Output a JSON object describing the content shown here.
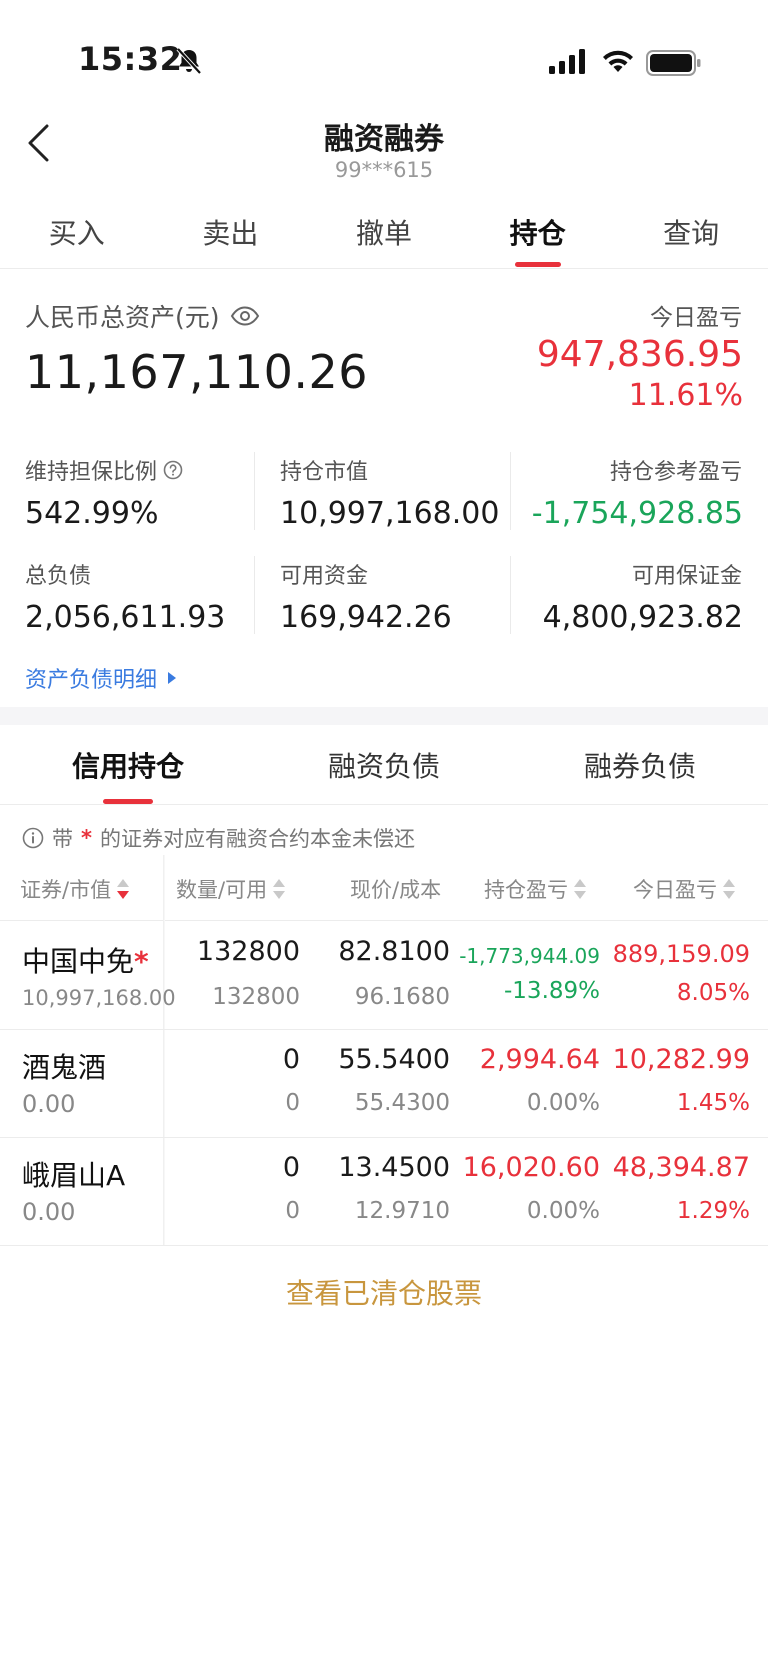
{
  "status_bar": {
    "time": "15:32"
  },
  "header": {
    "title": "融资融券",
    "account": "99***615"
  },
  "tabs": [
    {
      "label": "买入"
    },
    {
      "label": "卖出"
    },
    {
      "label": "撤单"
    },
    {
      "label": "持仓",
      "active": true
    },
    {
      "label": "查询"
    }
  ],
  "summary": {
    "total_assets_label": "人民币总资产(元)",
    "total_assets": "11,167,110.26",
    "today_pl_label": "今日盈亏",
    "today_pl_value": "947,836.95",
    "today_pl_pct": "11.61%",
    "metrics": {
      "maintenance_ratio_label": "维持担保比例",
      "maintenance_ratio": "542.99%",
      "position_mv_label": "持仓市值",
      "position_mv": "10,997,168.00",
      "position_pl_label": "持仓参考盈亏",
      "position_pl": "-1,754,928.85",
      "total_liab_label": "总负债",
      "total_liab": "2,056,611.93",
      "available_funds_label": "可用资金",
      "available_funds": "169,942.26",
      "available_margin_label": "可用保证金",
      "available_margin": "4,800,923.82"
    },
    "detail_link": "资产负债明细"
  },
  "sub_tabs": [
    {
      "label": "信用持仓",
      "active": true
    },
    {
      "label": "融资负债"
    },
    {
      "label": "融券负债"
    }
  ],
  "notice": {
    "prefix": "带",
    "star": "*",
    "suffix": "的证券对应有融资合约本金未偿还"
  },
  "table": {
    "headers": [
      "证券/市值",
      "数量/可用",
      "现价/成本",
      "持仓盈亏",
      "今日盈亏"
    ],
    "rows": [
      {
        "name": "中国中免",
        "star": "*",
        "mv": "10,997,168.00",
        "qty": "132800",
        "avail": "132800",
        "price": "82.8100",
        "cost": "96.1680",
        "pos_pl": "-1,773,944.09",
        "pos_pl_pct": "-13.89%",
        "today_pl": "889,159.09",
        "today_pl_pct": "8.05%"
      },
      {
        "name": "酒鬼酒",
        "star": "",
        "mv": "0.00",
        "qty": "0",
        "avail": "0",
        "price": "55.5400",
        "cost": "55.4300",
        "pos_pl": "2,994.64",
        "pos_pl_pct": "0.00%",
        "today_pl": "10,282.99",
        "today_pl_pct": "1.45%"
      },
      {
        "name": "峨眉山A",
        "star": "",
        "mv": "0.00",
        "qty": "0",
        "avail": "0",
        "price": "13.4500",
        "cost": "12.9710",
        "pos_pl": "16,020.60",
        "pos_pl_pct": "0.00%",
        "today_pl": "48,394.87",
        "today_pl_pct": "1.29%"
      }
    ]
  },
  "cleared_link": "查看已清仓股票",
  "colors": {
    "accent_red": "#e8313b",
    "gain_green": "#1aa55a",
    "link_blue": "#3a7be0",
    "gold": "#c8963e"
  }
}
